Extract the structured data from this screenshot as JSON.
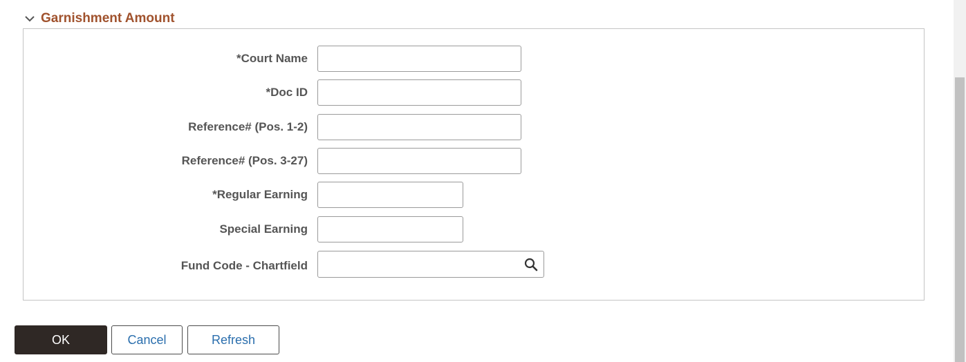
{
  "section": {
    "title": "Garnishment Amount"
  },
  "fields": [
    {
      "label": "*Court Name",
      "value": ""
    },
    {
      "label": "*Doc ID",
      "value": ""
    },
    {
      "label": "Reference# (Pos. 1-2)",
      "value": ""
    },
    {
      "label": "Reference# (Pos. 3-27)",
      "value": ""
    },
    {
      "label": "*Regular Earning",
      "value": ""
    },
    {
      "label": "Special Earning",
      "value": ""
    },
    {
      "label": "Fund Code - Chartfield",
      "value": ""
    }
  ],
  "buttons": {
    "ok": "OK",
    "cancel": "Cancel",
    "refresh": "Refresh"
  },
  "icons": {
    "collapse": "chevron-down-icon",
    "lookup": "search-icon"
  },
  "colors": {
    "section_title": "#a0522d",
    "primary_button": "#2f2825",
    "link_text": "#2a6ead"
  }
}
